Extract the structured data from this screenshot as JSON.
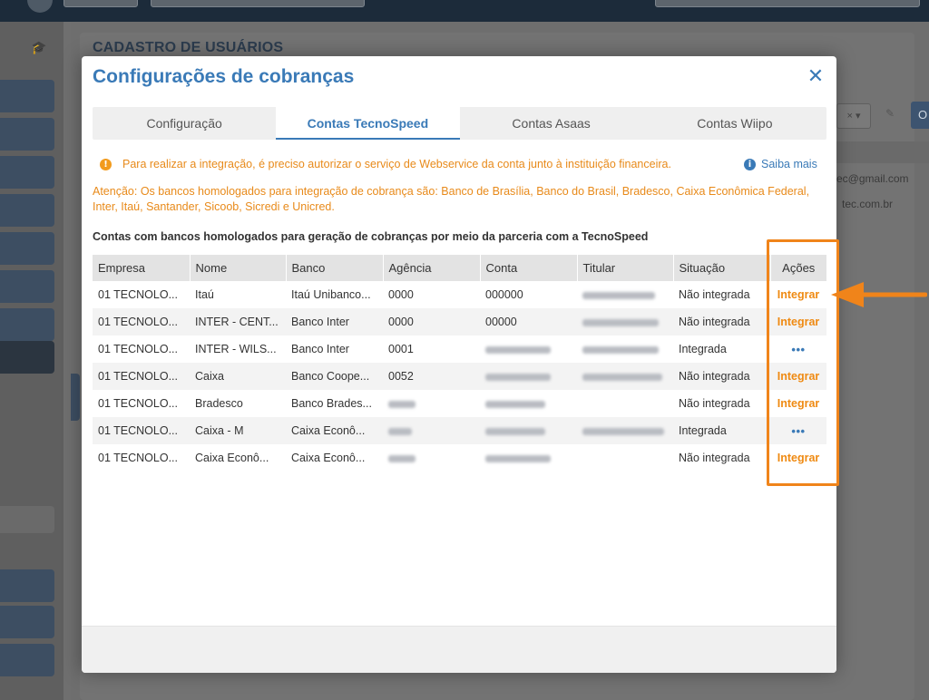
{
  "background": {
    "page_title": "CADASTRO DE USUÁRIOS",
    "emails": [
      "ec@gmail.com",
      "tec.com.br"
    ]
  },
  "modal": {
    "title": "Configurações de cobranças",
    "close_icon": "close-icon",
    "tabs": [
      {
        "label": "Configuração",
        "active": false
      },
      {
        "label": "Contas TecnoSpeed",
        "active": true
      },
      {
        "label": "Contas Asaas",
        "active": false
      },
      {
        "label": "Contas Wiipo",
        "active": false
      }
    ],
    "notice": "Para realizar a integração, é preciso autorizar o serviço de Webservice da conta junto à instituição financeira.",
    "saiba_mais": "Saiba mais",
    "warning": "Atenção: Os bancos homologados para integração de cobrança são: Banco de Brasília, Banco do Brasil, Bradesco, Caixa Econômica Federal, Inter, Itaú, Santander, Sicoob, Sicredi e Unicred.",
    "section_title": "Contas com bancos homologados para geração de cobranças por meio da parceria com a TecnoSpeed",
    "table": {
      "columns": [
        "Empresa",
        "Nome",
        "Banco",
        "Agência",
        "Conta",
        "Titular",
        "Situação",
        "Ações"
      ],
      "rows": [
        {
          "empresa": "01 TECNOLO...",
          "nome": "Itaú",
          "banco": "Itaú Unibanco...",
          "agencia": "0000",
          "conta": "000000",
          "situacao": "Não integrada",
          "acao": "Integrar"
        },
        {
          "empresa": "01 TECNOLO...",
          "nome": "INTER - CENT...",
          "banco": "Banco Inter",
          "agencia": "0000",
          "conta": "00000",
          "situacao": "Não integrada",
          "acao": "Integrar"
        },
        {
          "empresa": "01 TECNOLO...",
          "nome": "INTER - WILS...",
          "banco": "Banco Inter",
          "agencia": "0001",
          "conta": "",
          "situacao": "Integrada",
          "acao": "•••"
        },
        {
          "empresa": "01 TECNOLO...",
          "nome": "Caixa",
          "banco": "Banco Coope...",
          "agencia": "0052",
          "conta": "",
          "situacao": "Não integrada",
          "acao": "Integrar"
        },
        {
          "empresa": "01 TECNOLO...",
          "nome": "Bradesco",
          "banco": "Banco Brades...",
          "agencia": "",
          "conta": "",
          "situacao": "Não integrada",
          "acao": "Integrar"
        },
        {
          "empresa": "01 TECNOLO...",
          "nome": "Caixa - M",
          "banco": "Caixa Econô...",
          "agencia": "",
          "conta": "",
          "situacao": "Integrada",
          "acao": "•••"
        },
        {
          "empresa": "01 TECNOLO...",
          "nome": "Caixa Econô...",
          "banco": "Caixa Econô...",
          "agencia": "",
          "conta": "",
          "situacao": "Não integrada",
          "acao": "Integrar"
        }
      ]
    }
  },
  "colors": {
    "title_blue": "#3a7ab7",
    "warning_orange": "#e88a1a",
    "action_orange": "#ef8a12",
    "annotation_orange": "#f0841a"
  }
}
